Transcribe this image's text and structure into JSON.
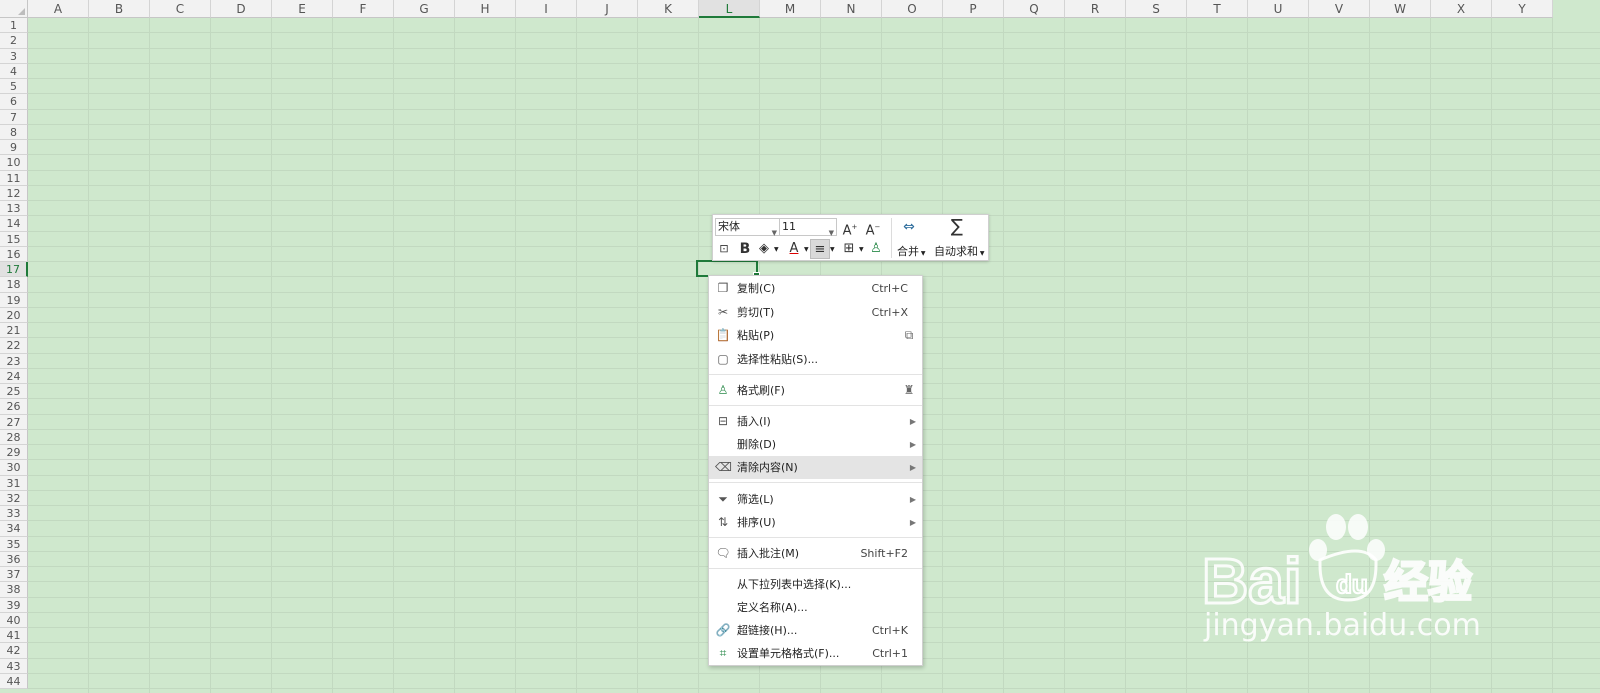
{
  "sheet": {
    "columns": [
      "A",
      "B",
      "C",
      "D",
      "E",
      "F",
      "G",
      "H",
      "I",
      "J",
      "K",
      "L",
      "M",
      "N",
      "O",
      "P",
      "Q",
      "R",
      "S",
      "T",
      "U",
      "V",
      "W",
      "X",
      "Y"
    ],
    "rows": [
      "1",
      "2",
      "3",
      "4",
      "5",
      "6",
      "7",
      "8",
      "9",
      "10",
      "11",
      "12",
      "13",
      "14",
      "15",
      "16",
      "17",
      "18",
      "19",
      "20",
      "21",
      "22",
      "23",
      "24",
      "25",
      "26",
      "27",
      "28",
      "29",
      "30",
      "31",
      "32",
      "33",
      "34",
      "35",
      "36",
      "37",
      "38",
      "39",
      "40",
      "41",
      "42",
      "43",
      "44"
    ],
    "selected_column": "L",
    "selected_row": "17",
    "colors": {
      "background": "#cfe8cd",
      "selection": "#1f7a3a"
    }
  },
  "mini_toolbar": {
    "font_name": "宋体",
    "font_size": "11",
    "merge_label": "合并",
    "autosum_label": "自动求和"
  },
  "context_menu": {
    "items": [
      {
        "icon": "copy-icon",
        "label": "复制(C)",
        "shortcut": "Ctrl+C"
      },
      {
        "icon": "scissors-icon",
        "label": "剪切(T)",
        "shortcut": "Ctrl+X"
      },
      {
        "icon": "paste-icon",
        "label": "粘贴(P)",
        "shortcut": ""
      },
      {
        "icon": "paste-special-icon",
        "label": "选择性粘贴(S)...",
        "shortcut": ""
      },
      {
        "icon": "format-painter-icon",
        "label": "格式刷(F)",
        "shortcut": ""
      },
      {
        "icon": "insert-icon",
        "label": "插入(I)",
        "shortcut": ""
      },
      {
        "icon": "",
        "label": "删除(D)",
        "shortcut": ""
      },
      {
        "icon": "eraser-icon",
        "label": "清除内容(N)",
        "shortcut": ""
      },
      {
        "icon": "filter-icon",
        "label": "筛选(L)",
        "shortcut": ""
      },
      {
        "icon": "sort-icon",
        "label": "排序(U)",
        "shortcut": ""
      },
      {
        "icon": "comment-icon",
        "label": "插入批注(M)",
        "shortcut": "Shift+F2"
      },
      {
        "icon": "",
        "label": "从下拉列表中选择(K)...",
        "shortcut": ""
      },
      {
        "icon": "",
        "label": "定义名称(A)...",
        "shortcut": ""
      },
      {
        "icon": "link-icon",
        "label": "超链接(H)...",
        "shortcut": "Ctrl+K"
      },
      {
        "icon": "cell-format-icon",
        "label": "设置单元格格式(F)...",
        "shortcut": "Ctrl+1"
      }
    ]
  },
  "watermark": {
    "brand": "Bai",
    "brand_tail": "经验",
    "url": "jingyan.baidu.com"
  }
}
